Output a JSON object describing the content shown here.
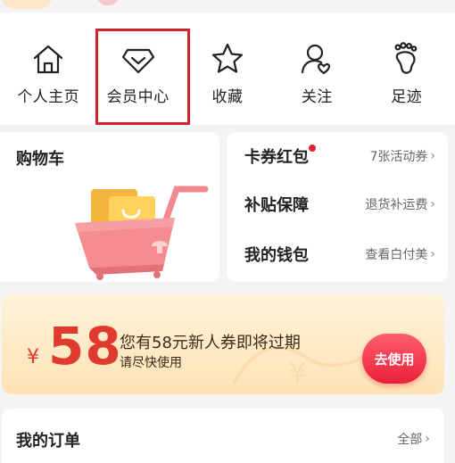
{
  "nav": {
    "items": [
      {
        "label": "个人主页",
        "icon": "home-icon"
      },
      {
        "label": "会员中心",
        "icon": "diamond-icon"
      },
      {
        "label": "收藏",
        "icon": "star-icon"
      },
      {
        "label": "关注",
        "icon": "user-heart-icon"
      },
      {
        "label": "足迹",
        "icon": "footprint-icon"
      }
    ]
  },
  "cart": {
    "title": "购物车"
  },
  "list": {
    "rows": [
      {
        "label": "卡券红包",
        "sub": "7张活动券"
      },
      {
        "label": "补贴保障",
        "sub": "退货补运费"
      },
      {
        "label": "我的钱包",
        "sub": "查看白付美"
      }
    ]
  },
  "coupon": {
    "currency": "¥",
    "amount": "58",
    "headline": "您有58元新人券即将过期",
    "subline": "请尽快使用",
    "button": "去使用"
  },
  "orders": {
    "title": "我的订单",
    "all": "全部"
  },
  "colors": {
    "accent": "#e2232a",
    "highlight_border": "#d3232e",
    "coupon_bg": "#ffe3b6"
  }
}
